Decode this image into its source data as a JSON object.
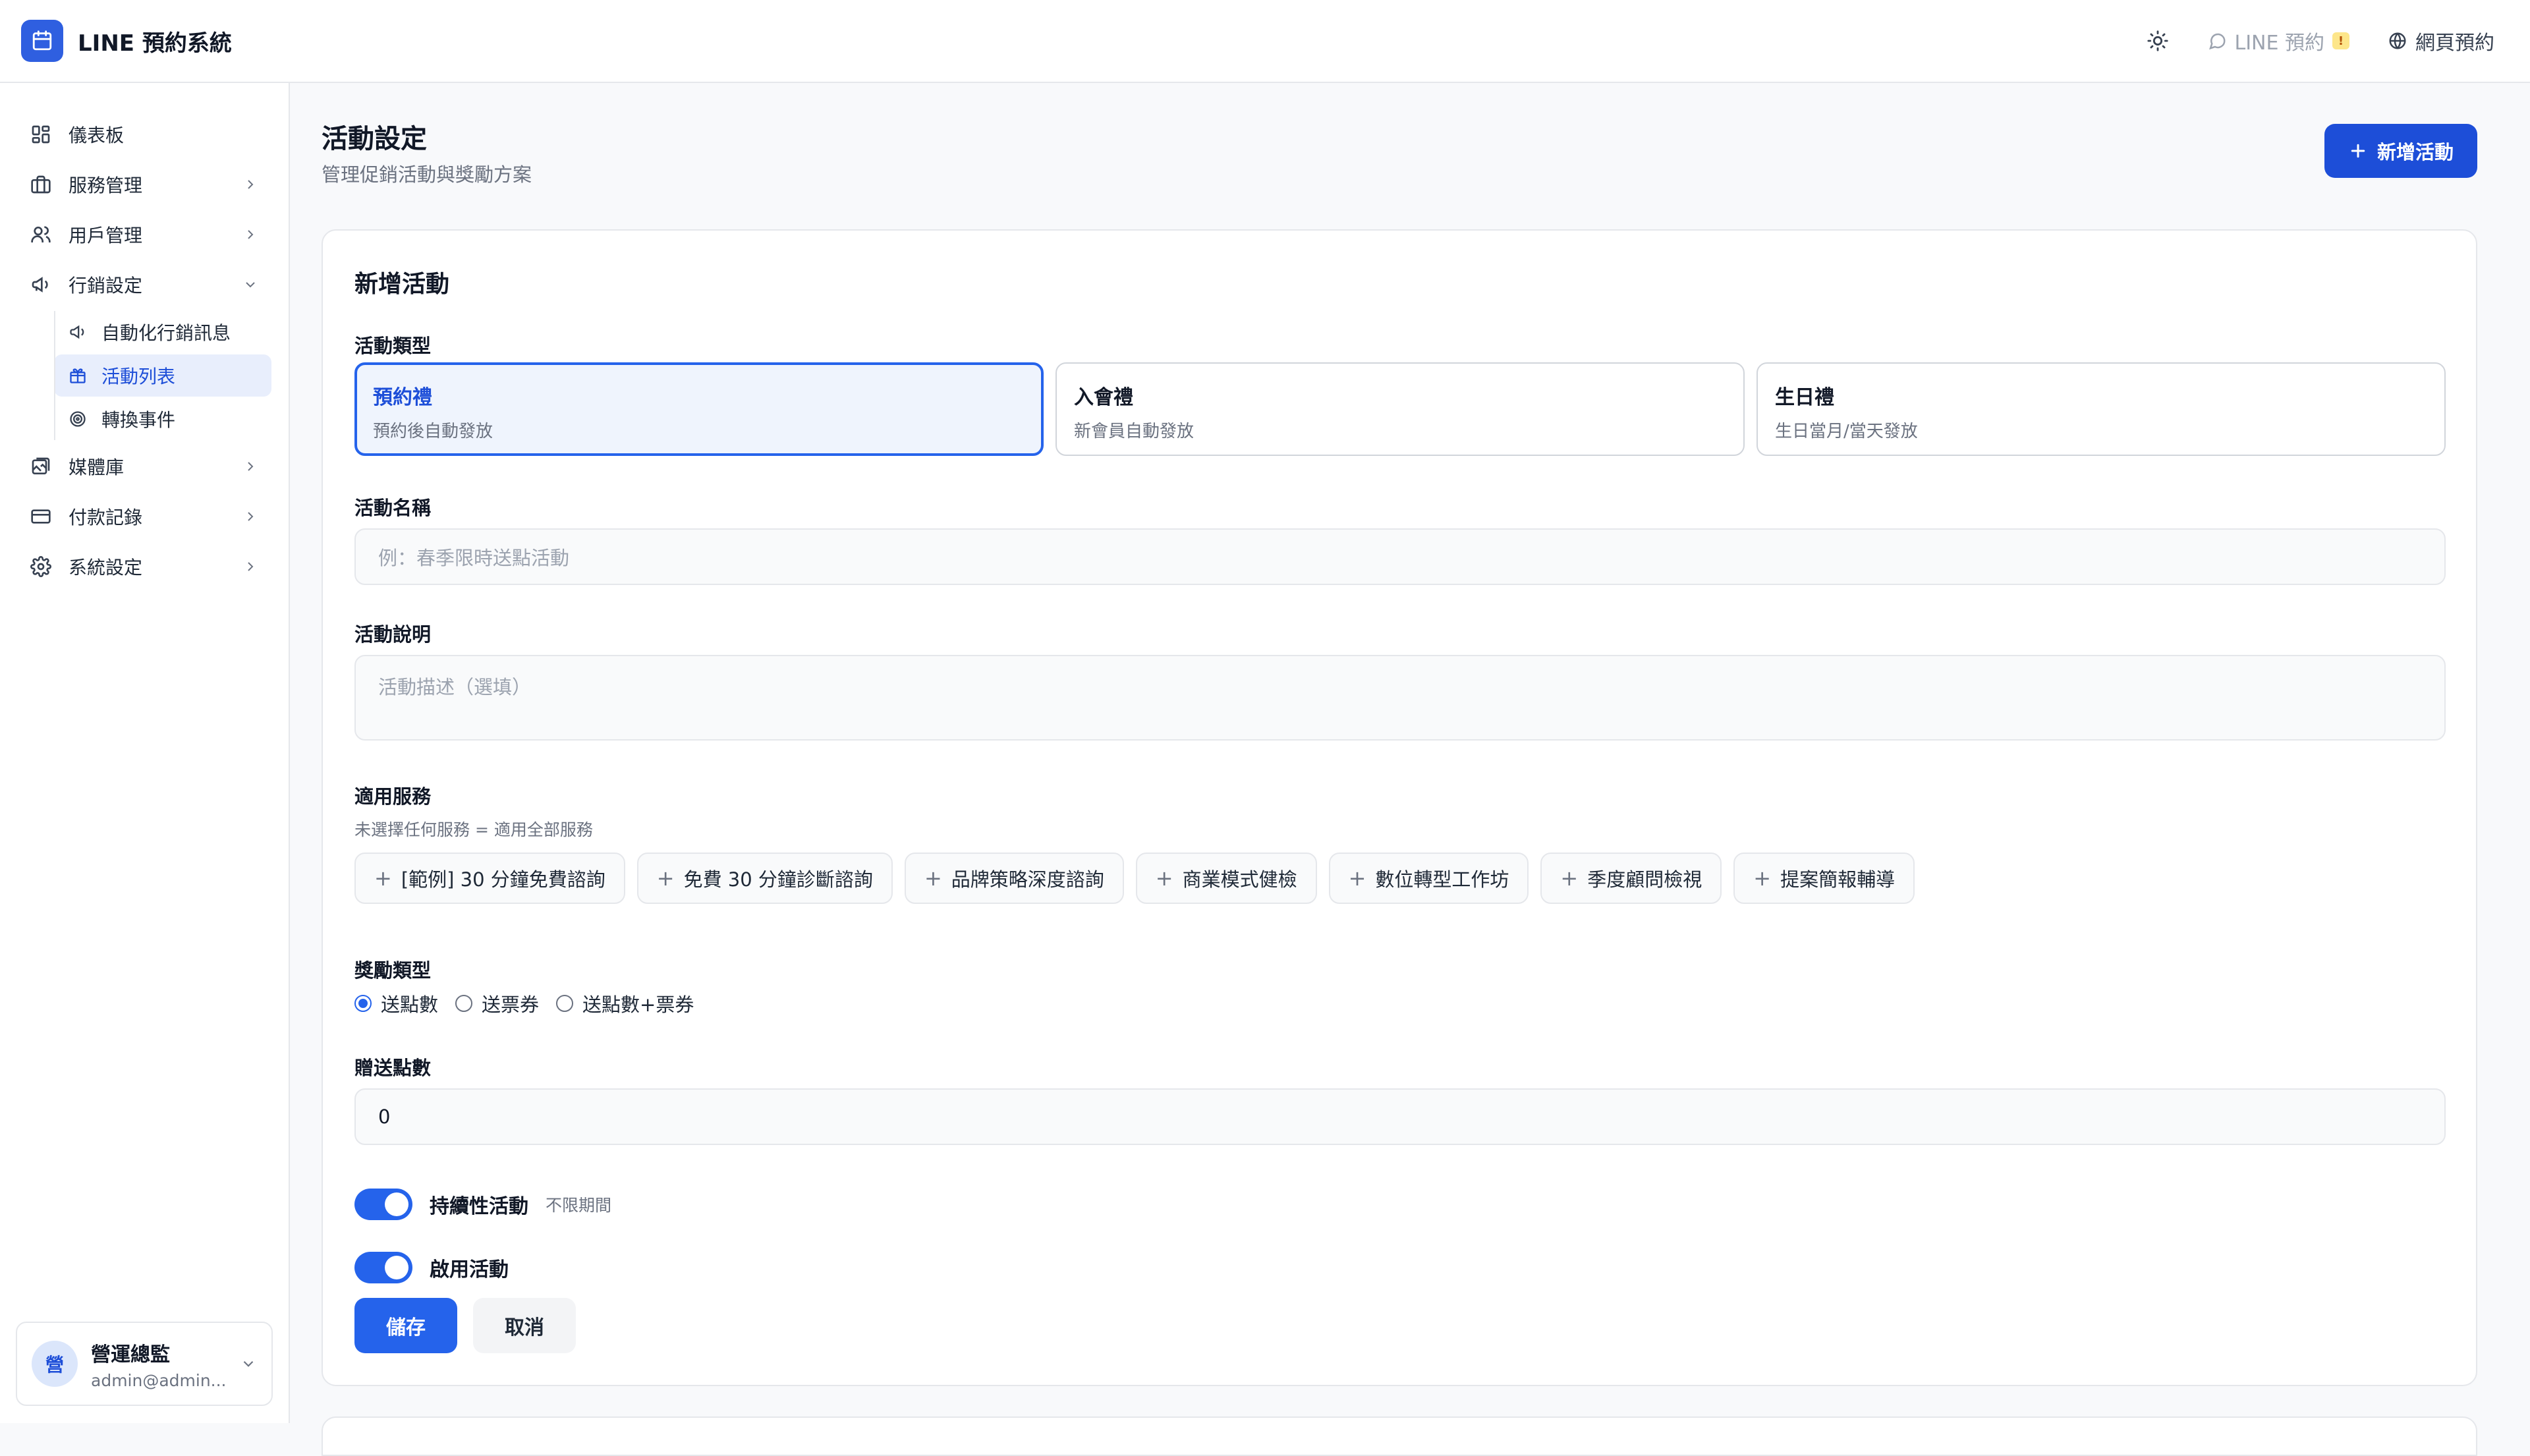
{
  "app": {
    "title": "LINE 預約系統"
  },
  "topbar": {
    "theme_icon": "sun-icon",
    "line_label": "LINE 預約",
    "web_label": "網頁預約"
  },
  "sidebar": {
    "items": [
      {
        "label": "儀表板",
        "icon": "dashboard-icon"
      },
      {
        "label": "服務管理",
        "icon": "briefcase-icon"
      },
      {
        "label": "用戶管理",
        "icon": "users-icon"
      },
      {
        "label": "行銷設定",
        "icon": "megaphone-icon"
      },
      {
        "label": "媒體庫",
        "icon": "image-icon"
      },
      {
        "label": "付款記錄",
        "icon": "credit-card-icon"
      },
      {
        "label": "系統設定",
        "icon": "gear-icon"
      }
    ],
    "marketing_sub": [
      {
        "label": "自動化行銷訊息",
        "icon": "megaphone-icon"
      },
      {
        "label": "活動列表",
        "icon": "gift-icon"
      },
      {
        "label": "轉換事件",
        "icon": "target-icon"
      }
    ],
    "user": {
      "avatar": "營",
      "name": "營運總監",
      "email": "admin@admin...."
    }
  },
  "page": {
    "title": "活動設定",
    "subtitle": "管理促銷活動與獎勵方案",
    "add_button": "新增活動"
  },
  "form": {
    "card_title": "新增活動",
    "type_label": "活動類型",
    "types": [
      {
        "title": "預約禮",
        "desc": "預約後自動發放",
        "selected": true
      },
      {
        "title": "入會禮",
        "desc": "新會員自動發放",
        "selected": false
      },
      {
        "title": "生日禮",
        "desc": "生日當月/當天發放",
        "selected": false
      }
    ],
    "name_label": "活動名稱",
    "name_placeholder": "例：春季限時送點活動",
    "desc_label": "活動說明",
    "desc_placeholder": "活動描述（選填）",
    "services_label": "適用服務",
    "services_helper": "未選擇任何服務 = 適用全部服務",
    "services": [
      "[範例] 30 分鐘免費諮詢",
      "免費 30 分鐘診斷諮詢",
      "品牌策略深度諮詢",
      "商業模式健檢",
      "數位轉型工作坊",
      "季度顧問檢視",
      "提案簡報輔導"
    ],
    "reward_label": "獎勵類型",
    "rewards": [
      {
        "label": "送點數",
        "checked": true
      },
      {
        "label": "送票券",
        "checked": false
      },
      {
        "label": "送點數+票券",
        "checked": false
      }
    ],
    "points_label": "贈送點數",
    "points_value": "0",
    "continuous_label": "持續性活動",
    "continuous_note": "不限期間",
    "enabled_label": "啟用活動",
    "save_label": "儲存",
    "cancel_label": "取消"
  },
  "colors": {
    "primary": "#2563eb",
    "primary_dark": "#1d4ed8"
  }
}
